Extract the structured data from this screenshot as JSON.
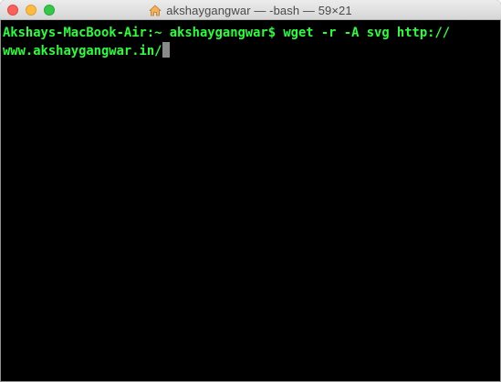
{
  "window": {
    "title": "akshaygangwar — -bash — 59×21",
    "title_icon": "home-folder-icon",
    "controls": {
      "close": "close-button",
      "minimize": "minimize-button",
      "zoom": "zoom-button"
    }
  },
  "terminal": {
    "lines": [
      "Akshays-MacBook-Air:~ akshaygangwar$ wget -r -A svg http://",
      "www.akshaygangwar.in/"
    ],
    "cursor_visible": true
  },
  "colors": {
    "text": "#2bff3b",
    "background": "#000000",
    "cursor": "#8a8a8a",
    "close": "#fc605c",
    "minimize": "#fdbc40",
    "zoom": "#34c84a"
  }
}
